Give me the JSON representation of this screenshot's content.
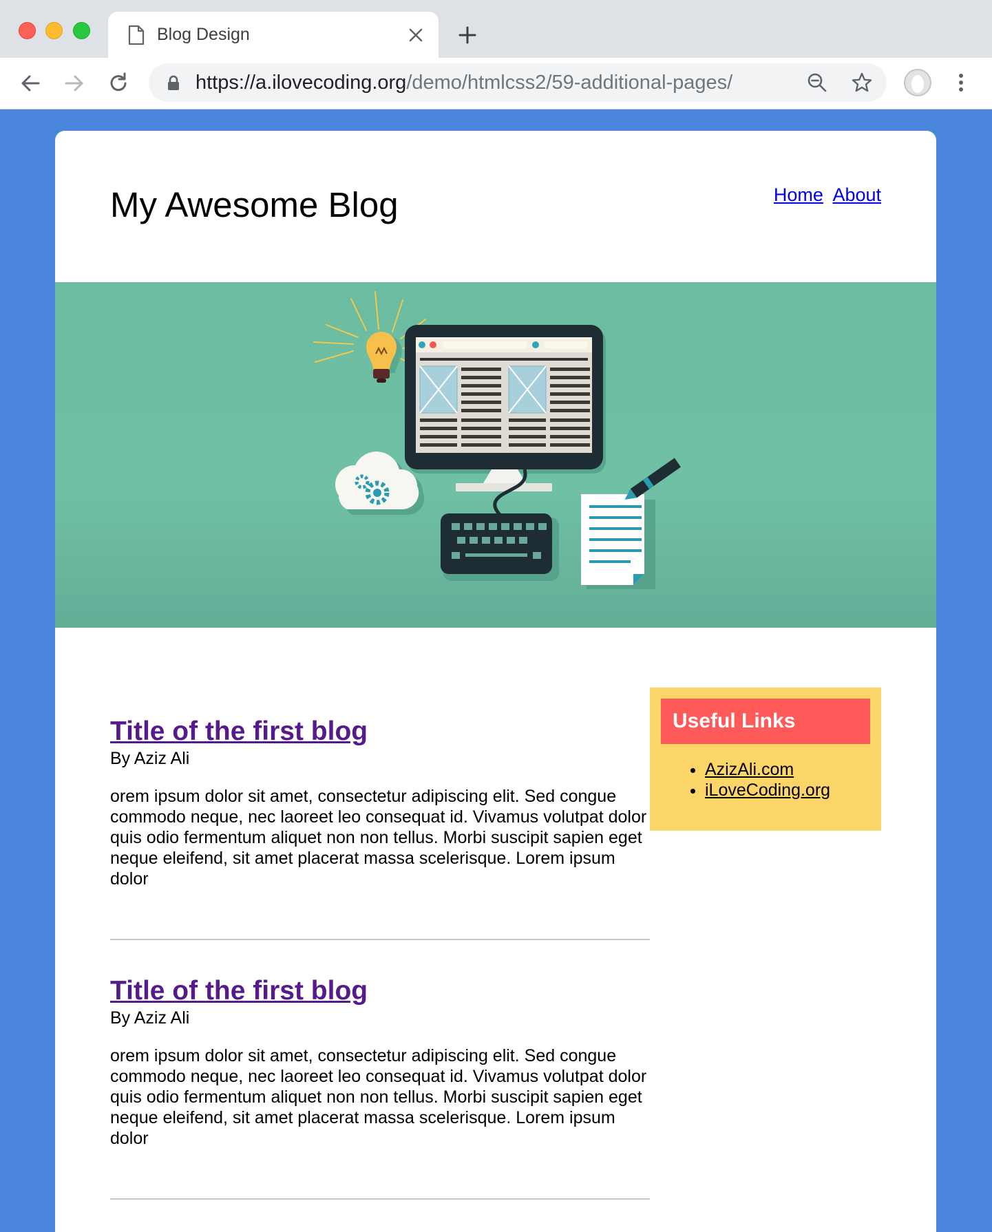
{
  "browser": {
    "tab_title": "Blog Design",
    "url_host": "https://a.ilovecoding.org",
    "url_path": "/demo/htmlcss2/59-additional-pages/",
    "icons": [
      "page-icon",
      "close-icon",
      "plus-icon",
      "back-icon",
      "forward-icon",
      "reload-icon",
      "lock-icon",
      "zoom-out-icon",
      "star-icon",
      "profile-avatar",
      "menu-icon"
    ]
  },
  "colors": {
    "page_background": "#4a87dc",
    "hero_background": "#6cbca2",
    "sidebar_background": "#fcd568",
    "sidebar_heading_background": "#fe5a5a",
    "post_title_color": "#551a8b",
    "nav_link_color": "#0000ee"
  },
  "header": {
    "site_title": "My Awesome Blog",
    "nav": [
      {
        "label": "Home"
      },
      {
        "label": "About"
      }
    ]
  },
  "hero": {
    "illustration": "computer-workspace-illustration"
  },
  "posts": [
    {
      "title": "Title of the first blog",
      "author": "By Aziz Ali",
      "body": "orem ipsum dolor sit amet, consectetur adipiscing elit. Sed congue commodo neque, nec laoreet leo consequat id. Vivamus volutpat dolor quis odio fermentum aliquet non non tellus. Morbi suscipit sapien eget neque eleifend, sit amet placerat massa scelerisque. Lorem ipsum dolor"
    },
    {
      "title": "Title of the first blog",
      "author": "By Aziz Ali",
      "body": "orem ipsum dolor sit amet, consectetur adipiscing elit. Sed congue commodo neque, nec laoreet leo consequat id. Vivamus volutpat dolor quis odio fermentum aliquet non non tellus. Morbi suscipit sapien eget neque eleifend, sit amet placerat massa scelerisque. Lorem ipsum dolor"
    }
  ],
  "sidebar": {
    "heading": "Useful Links",
    "links": [
      {
        "label": "AzizAli.com"
      },
      {
        "label": "iLoveCoding.org"
      }
    ]
  }
}
